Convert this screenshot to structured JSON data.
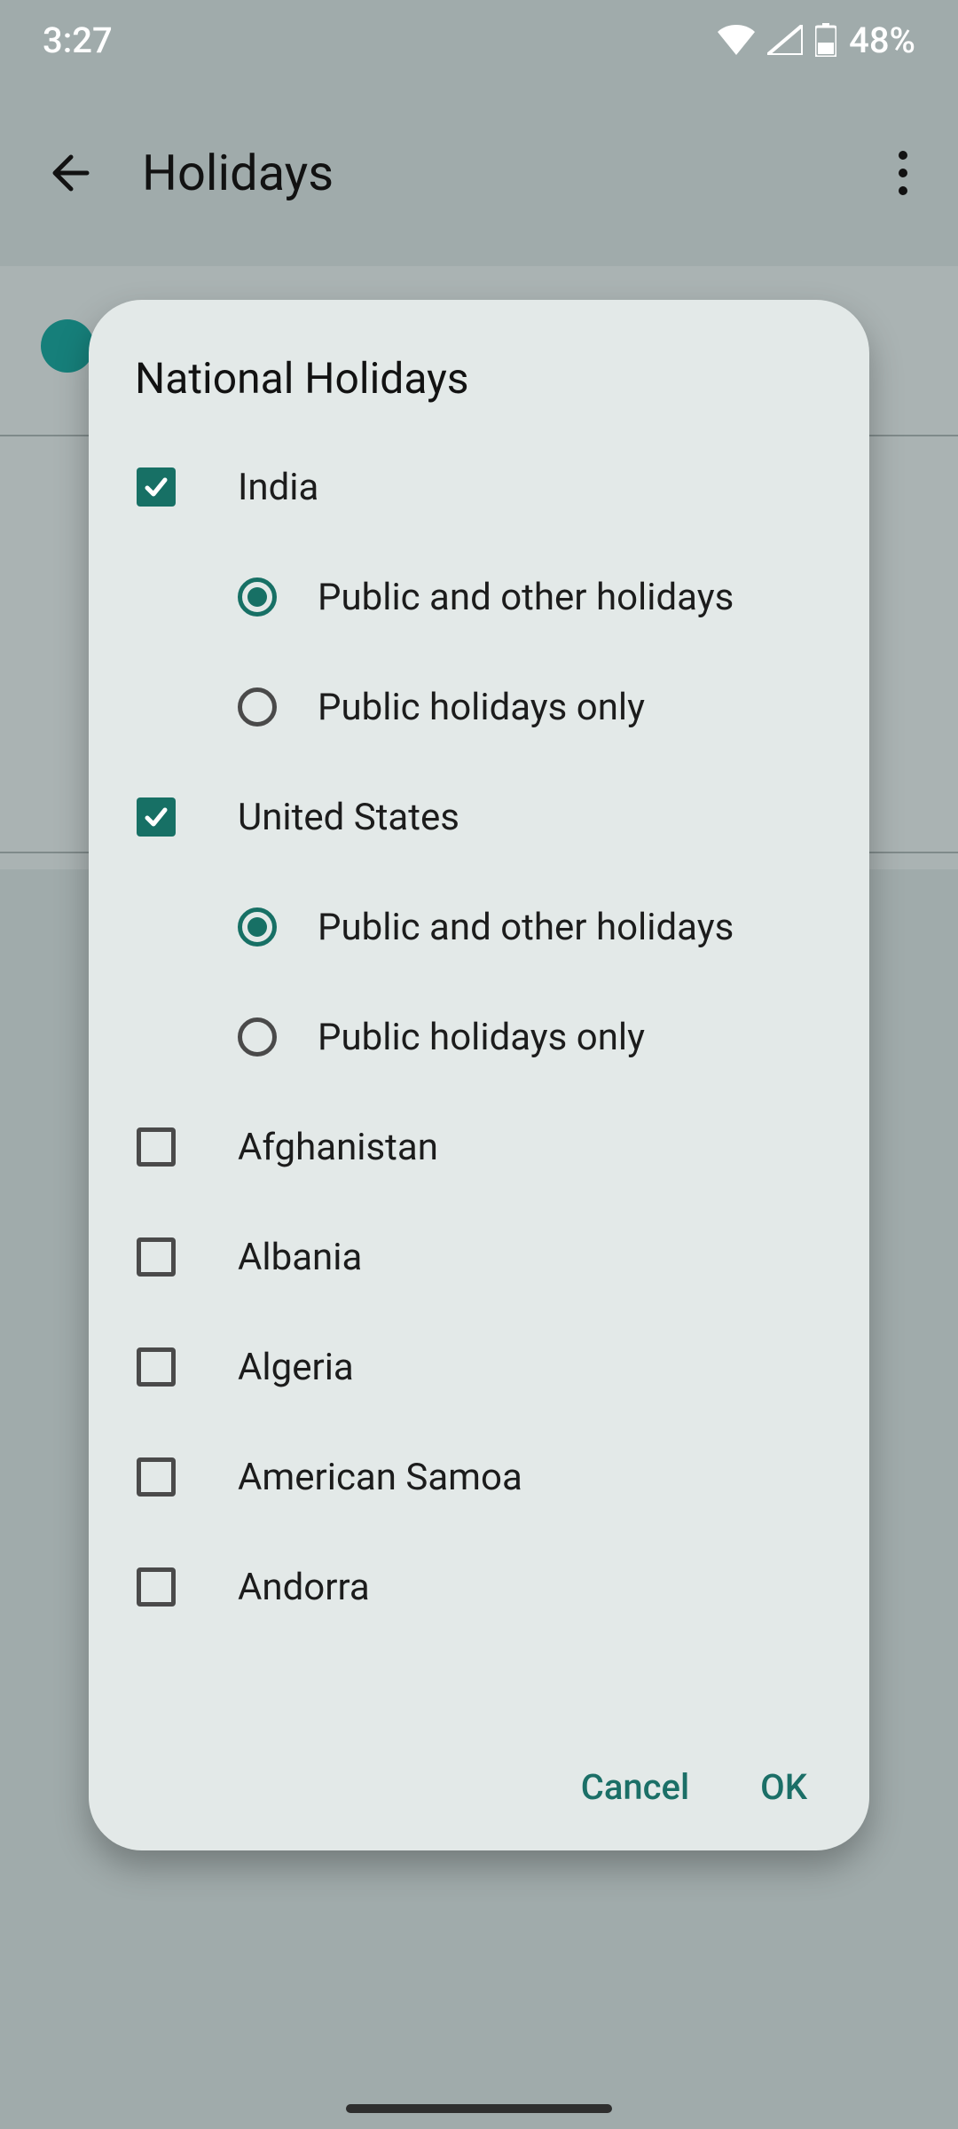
{
  "status": {
    "time": "3:27",
    "battery_text": "48%"
  },
  "appbar": {
    "title": "Holidays"
  },
  "dialog": {
    "title": "National Holidays",
    "option_all": "Public and other holidays",
    "option_public_only": "Public holidays only",
    "countries": {
      "india": "India",
      "united_states": "United States",
      "afghanistan": "Afghanistan",
      "albania": "Albania",
      "algeria": "Algeria",
      "american_samoa": "American Samoa",
      "andorra": "Andorra"
    },
    "buttons": {
      "cancel": "Cancel",
      "ok": "OK"
    }
  }
}
